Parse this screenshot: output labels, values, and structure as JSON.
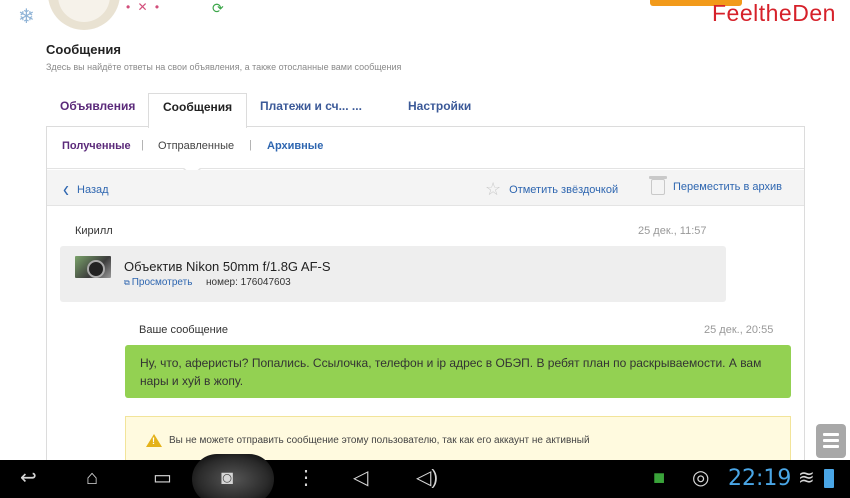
{
  "watermark": "FeeltheDen",
  "page": {
    "title": "Сообщения",
    "subtitle": "Здесь вы найдёте ответы на свои объявления, а также отосланные вами сообщения"
  },
  "tabs": [
    "Объявления",
    "Сообщения",
    "Платежи и сч... ...",
    "Настройки"
  ],
  "subtabs": {
    "received": "Полученные",
    "sent": "Отправленные",
    "archive": "Архивные",
    "separator": "|"
  },
  "actions": {
    "back": "Назад",
    "star": "Отметить звёздочкой",
    "archive": "Переместить в архив"
  },
  "message": {
    "sender": "Кирилл",
    "time": "25 дек., 11:57",
    "ad_title": "Объектив Nikon 50mm f/1.8G AF-S",
    "ad_view": "Просмотреть",
    "ad_number": "номер: 176047603"
  },
  "reply": {
    "label": "Ваше сообщение",
    "time": "25 дек., 20:55",
    "text": "Ну, что, аферисты? Попались. Ссылочка, телефон и ip адрес в ОБЭП. В ребят план по раскрываемости. А вам нары и хуй в жопу."
  },
  "warning": "Вы не можете отправить сообщение этому пользователю, так как его аккаунт не активный",
  "system_bar": {
    "clock": "22:19"
  },
  "colors": {
    "accent_blue": "#2e66b0",
    "purple": "#5b2a7a",
    "reply_green": "#93d152",
    "warning_bg": "#fffadf",
    "clock_blue": "#4aa6e6"
  },
  "icons": [
    "snowflake-icon",
    "back-chevron-icon",
    "star-icon",
    "trash-icon",
    "external-link-icon",
    "warning-icon",
    "nav-back-icon",
    "nav-home-icon",
    "nav-recent-icon",
    "screenshot-icon",
    "menu-icon",
    "volume-down-icon",
    "volume-up-icon",
    "app-icon",
    "camera-icon",
    "wifi-icon",
    "battery-icon"
  ]
}
